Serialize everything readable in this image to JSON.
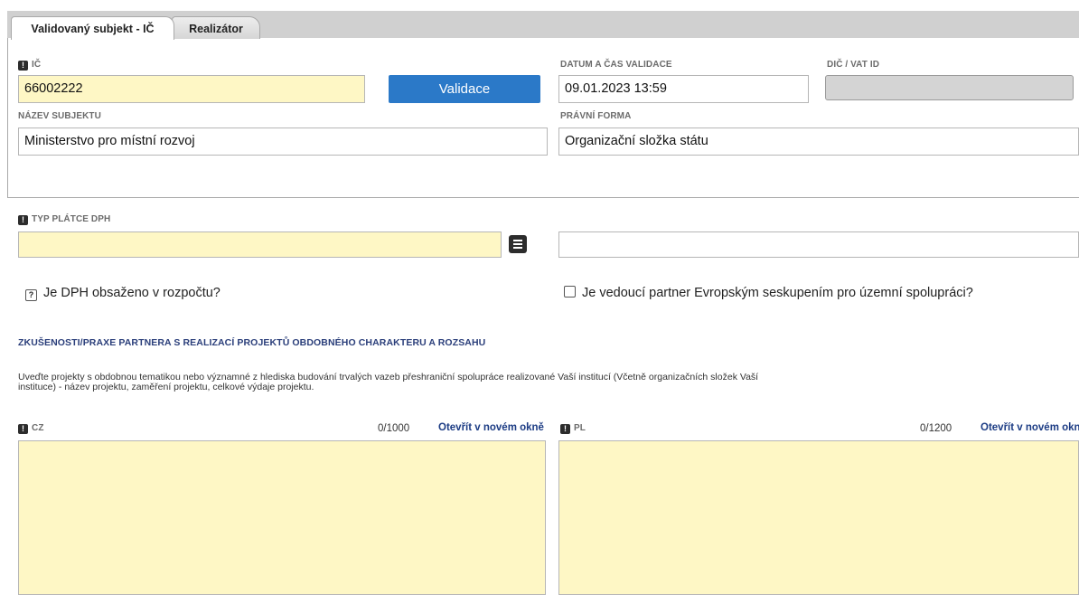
{
  "tabs": [
    {
      "label": "Validovaný subjekt - IČ",
      "active": true
    },
    {
      "label": "Realizátor",
      "active": false
    }
  ],
  "validation": {
    "ic": {
      "label": "IČ",
      "value": "66002222"
    },
    "validate_button": "Validace",
    "datetime": {
      "label": "DATUM A ČAS VALIDACE",
      "value": "09.01.2023 13:59"
    },
    "dic": {
      "label": "DIČ / VAT ID",
      "value": ""
    },
    "name": {
      "label": "NÁZEV SUBJEKTU",
      "value": "Ministerstvo pro místní rozvoj"
    },
    "legal_form": {
      "label": "PRÁVNÍ FORMA",
      "value": "Organizační složka státu"
    }
  },
  "vat": {
    "label": "TYP PLÁTCE DPH",
    "value": "",
    "description_value": ""
  },
  "checkboxes": {
    "dph_in_budget": {
      "label": "Je DPH obsaženo v rozpočtu?",
      "state": "?"
    },
    "egtc_lead": {
      "label": "Je vedoucí partner Evropským seskupením pro územní spolupráci?",
      "state": ""
    }
  },
  "experience": {
    "heading": "ZKUŠENOSTI/PRAXE PARTNERA S REALIZACÍ PROJEKTŮ OBDOBNÉHO CHARAKTERU A ROZSAHU",
    "description": "Uveďte projekty s obdobnou tematikou nebo významné z hlediska budování trvalých vazeb přeshraniční spolupráce realizované Vaší institucí (Včetně organizačních složek Vaší instituce) - název projektu, zaměření projektu, celkové výdaje projektu.",
    "cz": {
      "label": "CZ",
      "counter": "0/1000",
      "open_link": "Otevřít v novém okně",
      "value": ""
    },
    "pl": {
      "label": "PL",
      "counter": "0/1200",
      "open_link": "Otevřít v novém okně",
      "value": ""
    }
  }
}
